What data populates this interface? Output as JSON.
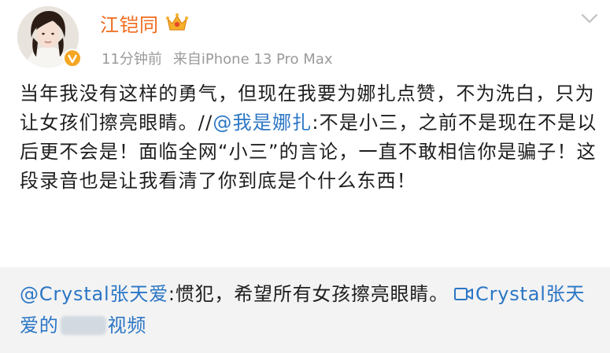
{
  "user": {
    "name": "江铠同",
    "time": "11分钟前",
    "source": "来自iPhone 13 Pro Max",
    "verified_icon": "verified-badge-icon",
    "crown_icon": "vip-crown-icon"
  },
  "post": {
    "text_part1": "当年我没有这样的勇气，但现在我要为娜扎点赞，不为洗白，只为让女孩们擦亮眼睛。//",
    "mention": "@我是娜扎",
    "text_part2": ":不是小三，之前不是现在不是以后更不会是！面临全网“小三”的言论，一直不敢相信你是骗子！这段录音也是让我看清了你到底是个什么东西！"
  },
  "repost": {
    "mention": "@Crystal张天爱",
    "text": ":惯犯，希望所有女孩擦亮眼睛。",
    "video_link_prefix": "Crystal张天爱的",
    "video_link_suffix": "视频"
  },
  "colors": {
    "name": "#f06b1b",
    "link": "#2b76c5",
    "meta": "#9a9a9a",
    "repost_bg": "#f3f3f3"
  }
}
